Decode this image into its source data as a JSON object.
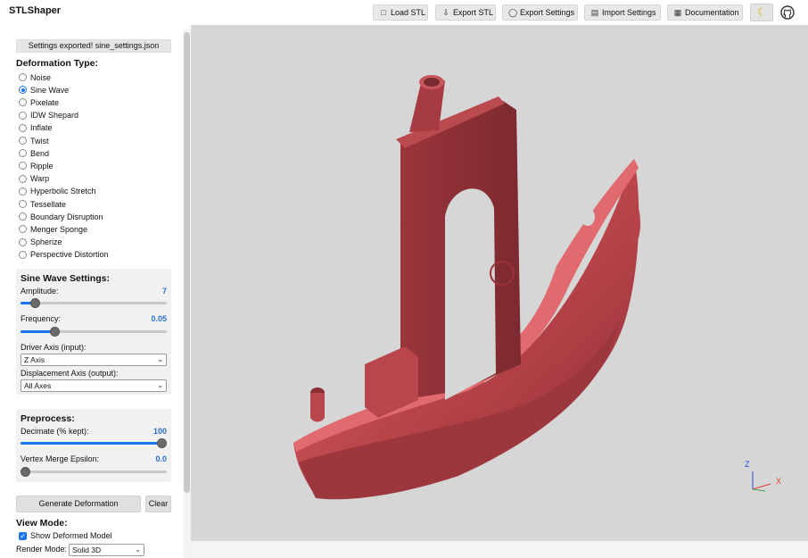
{
  "header": {
    "title": "STLShaper",
    "buttons": [
      {
        "label": "Load STL",
        "icon": "file-icon"
      },
      {
        "label": "Export STL",
        "icon": "download-icon"
      },
      {
        "label": "Export Settings",
        "icon": "lightbulb-icon"
      },
      {
        "label": "Import Settings",
        "icon": "document-icon"
      },
      {
        "label": "Documentation",
        "icon": "book-icon"
      }
    ],
    "theme_icon": "moon-icon",
    "github_icon": "github-icon"
  },
  "sidebar": {
    "status": "Settings exported! sine_settings.json",
    "deformation_title": "Deformation Type:",
    "deformation_types": [
      {
        "label": "Noise",
        "checked": false
      },
      {
        "label": "Sine Wave",
        "checked": true
      },
      {
        "label": "Pixelate",
        "checked": false
      },
      {
        "label": "IDW Shepard",
        "checked": false
      },
      {
        "label": "Inflate",
        "checked": false
      },
      {
        "label": "Twist",
        "checked": false
      },
      {
        "label": "Bend",
        "checked": false
      },
      {
        "label": "Ripple",
        "checked": false
      },
      {
        "label": "Warp",
        "checked": false
      },
      {
        "label": "Hyperbolic Stretch",
        "checked": false
      },
      {
        "label": "Tessellate",
        "checked": false
      },
      {
        "label": "Boundary Disruption",
        "checked": false
      },
      {
        "label": "Menger Sponge",
        "checked": false
      },
      {
        "label": "Spherize",
        "checked": false
      },
      {
        "label": "Perspective Distortion",
        "checked": false
      }
    ],
    "sine": {
      "title": "Sine Wave Settings:",
      "amplitude_label": "Amplitude:",
      "amplitude_value": "7",
      "amplitude_level": 0.1,
      "frequency_label": "Frequency:",
      "frequency_value": "0.05",
      "frequency_level": 0.23,
      "driver_label": "Driver Axis (input):",
      "driver_value": "Z Axis",
      "displacement_label": "Displacement Axis (output):",
      "displacement_value": "All Axes"
    },
    "preprocess": {
      "title": "Preprocess:",
      "decimate_label": "Decimate (% kept):",
      "decimate_value": "100",
      "decimate_level": 1.0,
      "epsilon_label": "Vertex Merge Epsilon:",
      "epsilon_value": "0.0",
      "epsilon_level": 0.0
    },
    "generate_label": "Generate Deformation",
    "clear_label": "Clear",
    "view_title": "View Mode:",
    "show_deformed_label": "Show Deformed Model",
    "show_deformed_checked": true,
    "render_mode_label": "Render Mode:",
    "render_mode_value": "Solid 3D"
  },
  "viewport": {
    "axis_labels": {
      "z": "Z",
      "x": "X"
    },
    "model_color": "#c44a4f",
    "background": "#d6d6d6"
  }
}
